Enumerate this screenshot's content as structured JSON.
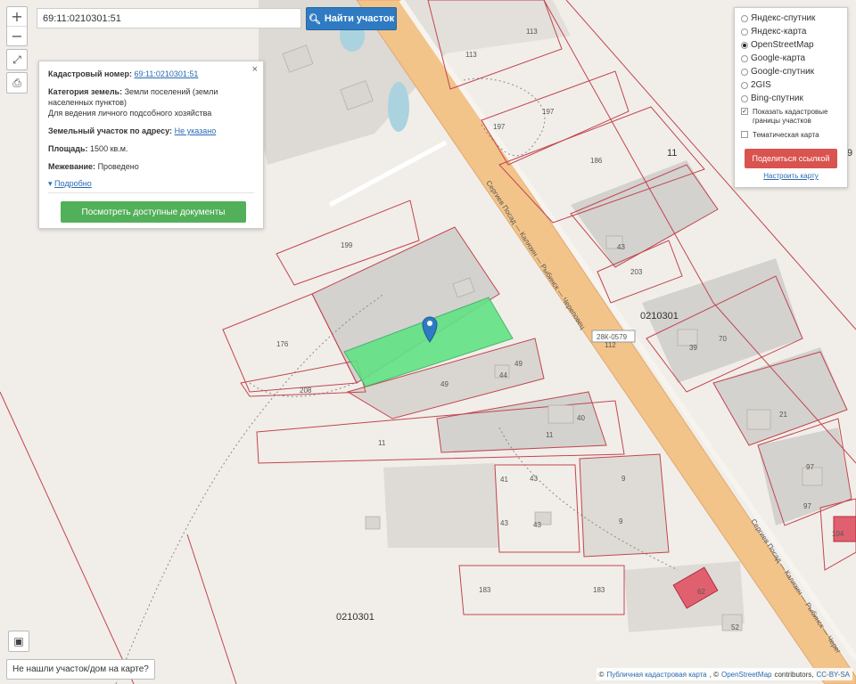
{
  "search": {
    "value": "69:11:0210301:51",
    "button_label": "Найти участок"
  },
  "zoom": {
    "in": "+",
    "out": "−"
  },
  "info_panel": {
    "cadastral_label": "Кадастровый номер:",
    "cadastral_value": "69:11:0210301:51",
    "category_label": "Категория земель:",
    "category_value": "Земли поселений (земли населенных пунктов)",
    "use_value": "Для ведения личного подсобного хозяйства",
    "address_label": "Земельный участок по адресу:",
    "address_value": "Не указано",
    "area_label": "Площадь:",
    "area_value": "1500 кв.м.",
    "survey_label": "Межевание:",
    "survey_value": "Проведено",
    "more_label": "Подробно",
    "docs_button": "Посмотреть доступные документы"
  },
  "layers": {
    "options": [
      "Яндекс-спутник",
      "Яндекс-карта",
      "OpenStreetMap",
      "Google-карта",
      "Google-спутник",
      "2GIS",
      "Bing-спутник"
    ],
    "selected": "OpenStreetMap",
    "show_cadastral": "Показать кадастровые границы участков",
    "thematic": "Тематическая карта",
    "share_button": "Поделиться ссылкой",
    "setup_link": "Настроить карту"
  },
  "map_labels": {
    "road_top": "Сергиев Посад — Калязин — Рыбинск — Череповец",
    "road_bottom": "Сергиев Посад — Калязин — Рыбинск — Черег",
    "road_code": "28К-0579",
    "quarter_center": "0210301",
    "quarter_bottom": "0210301",
    "big11": "11",
    "edge9": "9",
    "parcels": [
      "113",
      "113",
      "197",
      "197",
      "186",
      "199",
      "43",
      "203",
      "176",
      "49",
      "49",
      "44",
      "70",
      "39",
      "208",
      "40",
      "11",
      "11",
      "21",
      "97",
      "97",
      "43",
      "43",
      "41",
      "43",
      "9",
      "9",
      "104",
      "183",
      "183",
      "52",
      "62",
      "112"
    ]
  },
  "not_found": "Не нашли участок/дом на карте?",
  "attribution": {
    "a": "Публичная кадастровая карта",
    "b": "OpenStreetMap",
    "c": "contributors,",
    "d": "CC-BY-SA"
  },
  "colors": {
    "road": "#f2c48a",
    "parcel_border": "#c2454f",
    "selected_parcel": "#62e284",
    "water": "#aad3df",
    "building": "#d9d6d1"
  }
}
